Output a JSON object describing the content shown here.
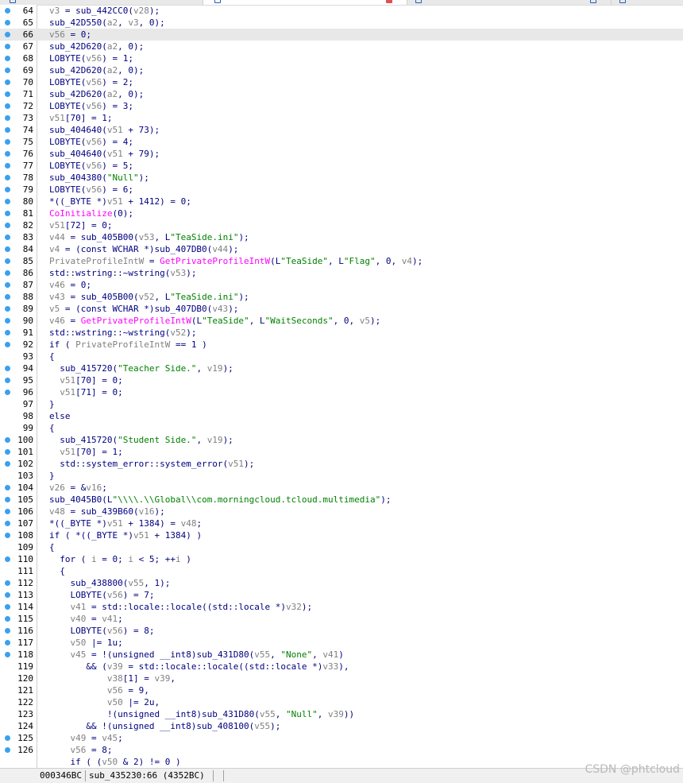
{
  "code_lines": [
    {
      "n": "64",
      "bp": true,
      "hl": false,
      "segs": [
        {
          "t": "v3",
          "c": "var"
        },
        {
          "t": " = sub_442CC0("
        },
        {
          "t": "v28",
          "c": "var"
        },
        {
          "t": ");"
        }
      ]
    },
    {
      "n": "65",
      "bp": true,
      "hl": false,
      "segs": [
        {
          "t": "sub_42D550("
        },
        {
          "t": "a2",
          "c": "var"
        },
        {
          "t": ", "
        },
        {
          "t": "v3",
          "c": "var"
        },
        {
          "t": ", 0);"
        }
      ]
    },
    {
      "n": "66",
      "bp": true,
      "hl": true,
      "segs": [
        {
          "t": "v56",
          "c": "var"
        },
        {
          "t": " = 0;"
        }
      ]
    },
    {
      "n": "67",
      "bp": true,
      "hl": false,
      "segs": [
        {
          "t": "sub_42D620("
        },
        {
          "t": "a2",
          "c": "var"
        },
        {
          "t": ", 0);"
        }
      ]
    },
    {
      "n": "68",
      "bp": true,
      "hl": false,
      "segs": [
        {
          "t": "LOBYTE("
        },
        {
          "t": "v56",
          "c": "var"
        },
        {
          "t": ") = 1;"
        }
      ]
    },
    {
      "n": "69",
      "bp": true,
      "hl": false,
      "segs": [
        {
          "t": "sub_42D620("
        },
        {
          "t": "a2",
          "c": "var"
        },
        {
          "t": ", 0);"
        }
      ]
    },
    {
      "n": "70",
      "bp": true,
      "hl": false,
      "segs": [
        {
          "t": "LOBYTE("
        },
        {
          "t": "v56",
          "c": "var"
        },
        {
          "t": ") = 2;"
        }
      ]
    },
    {
      "n": "71",
      "bp": true,
      "hl": false,
      "segs": [
        {
          "t": "sub_42D620("
        },
        {
          "t": "a2",
          "c": "var"
        },
        {
          "t": ", 0);"
        }
      ]
    },
    {
      "n": "72",
      "bp": true,
      "hl": false,
      "segs": [
        {
          "t": "LOBYTE("
        },
        {
          "t": "v56",
          "c": "var"
        },
        {
          "t": ") = 3;"
        }
      ]
    },
    {
      "n": "73",
      "bp": true,
      "hl": false,
      "segs": [
        {
          "t": "v51",
          "c": "var"
        },
        {
          "t": "[70] = 1;"
        }
      ]
    },
    {
      "n": "74",
      "bp": true,
      "hl": false,
      "segs": [
        {
          "t": "sub_404640("
        },
        {
          "t": "v51",
          "c": "var"
        },
        {
          "t": " + 73);"
        }
      ]
    },
    {
      "n": "75",
      "bp": true,
      "hl": false,
      "segs": [
        {
          "t": "LOBYTE("
        },
        {
          "t": "v56",
          "c": "var"
        },
        {
          "t": ") = 4;"
        }
      ]
    },
    {
      "n": "76",
      "bp": true,
      "hl": false,
      "segs": [
        {
          "t": "sub_404640("
        },
        {
          "t": "v51",
          "c": "var"
        },
        {
          "t": " + 79);"
        }
      ]
    },
    {
      "n": "77",
      "bp": true,
      "hl": false,
      "segs": [
        {
          "t": "LOBYTE("
        },
        {
          "t": "v56",
          "c": "var"
        },
        {
          "t": ") = 5;"
        }
      ]
    },
    {
      "n": "78",
      "bp": true,
      "hl": false,
      "segs": [
        {
          "t": "sub_404380("
        },
        {
          "t": "\"Null\"",
          "c": "str"
        },
        {
          "t": ");"
        }
      ]
    },
    {
      "n": "79",
      "bp": true,
      "hl": false,
      "segs": [
        {
          "t": "LOBYTE("
        },
        {
          "t": "v56",
          "c": "var"
        },
        {
          "t": ") = 6;"
        }
      ]
    },
    {
      "n": "80",
      "bp": true,
      "hl": false,
      "segs": [
        {
          "t": "*((_BYTE *)"
        },
        {
          "t": "v51",
          "c": "var"
        },
        {
          "t": " + 1412) = 0;"
        }
      ]
    },
    {
      "n": "81",
      "bp": true,
      "hl": false,
      "segs": [
        {
          "t": "CoInitialize",
          "c": "fn"
        },
        {
          "t": "(0);"
        }
      ]
    },
    {
      "n": "82",
      "bp": true,
      "hl": false,
      "segs": [
        {
          "t": "v51",
          "c": "var"
        },
        {
          "t": "[72] = 0;"
        }
      ]
    },
    {
      "n": "83",
      "bp": true,
      "hl": false,
      "segs": [
        {
          "t": "v44",
          "c": "var"
        },
        {
          "t": " = sub_405B00("
        },
        {
          "t": "v53",
          "c": "var"
        },
        {
          "t": ", L"
        },
        {
          "t": "\"TeaSide.ini\"",
          "c": "str"
        },
        {
          "t": ");"
        }
      ]
    },
    {
      "n": "84",
      "bp": true,
      "hl": false,
      "segs": [
        {
          "t": "v4",
          "c": "var"
        },
        {
          "t": " = (const WCHAR *)sub_407DB0("
        },
        {
          "t": "v44",
          "c": "var"
        },
        {
          "t": ");"
        }
      ]
    },
    {
      "n": "85",
      "bp": true,
      "hl": false,
      "segs": [
        {
          "t": "PrivateProfileIntW",
          "c": "var"
        },
        {
          "t": " = "
        },
        {
          "t": "GetPrivateProfileIntW",
          "c": "fn"
        },
        {
          "t": "(L"
        },
        {
          "t": "\"TeaSide\"",
          "c": "str"
        },
        {
          "t": ", L"
        },
        {
          "t": "\"Flag\"",
          "c": "str"
        },
        {
          "t": ", 0, "
        },
        {
          "t": "v4",
          "c": "var"
        },
        {
          "t": ");"
        }
      ]
    },
    {
      "n": "86",
      "bp": true,
      "hl": false,
      "segs": [
        {
          "t": "std::wstring::~wstring("
        },
        {
          "t": "v53",
          "c": "var"
        },
        {
          "t": ");"
        }
      ]
    },
    {
      "n": "87",
      "bp": true,
      "hl": false,
      "segs": [
        {
          "t": "v46",
          "c": "var"
        },
        {
          "t": " = 0;"
        }
      ]
    },
    {
      "n": "88",
      "bp": true,
      "hl": false,
      "segs": [
        {
          "t": "v43",
          "c": "var"
        },
        {
          "t": " = sub_405B00("
        },
        {
          "t": "v52",
          "c": "var"
        },
        {
          "t": ", L"
        },
        {
          "t": "\"TeaSide.ini\"",
          "c": "str"
        },
        {
          "t": ");"
        }
      ]
    },
    {
      "n": "89",
      "bp": true,
      "hl": false,
      "segs": [
        {
          "t": "v5",
          "c": "var"
        },
        {
          "t": " = (const WCHAR *)sub_407DB0("
        },
        {
          "t": "v43",
          "c": "var"
        },
        {
          "t": ");"
        }
      ]
    },
    {
      "n": "90",
      "bp": true,
      "hl": false,
      "segs": [
        {
          "t": "v46",
          "c": "var"
        },
        {
          "t": " = "
        },
        {
          "t": "GetPrivateProfileIntW",
          "c": "fn"
        },
        {
          "t": "(L"
        },
        {
          "t": "\"TeaSide\"",
          "c": "str"
        },
        {
          "t": ", L"
        },
        {
          "t": "\"WaitSeconds\"",
          "c": "str"
        },
        {
          "t": ", 0, "
        },
        {
          "t": "v5",
          "c": "var"
        },
        {
          "t": ");"
        }
      ]
    },
    {
      "n": "91",
      "bp": true,
      "hl": false,
      "segs": [
        {
          "t": "std::wstring::~wstring("
        },
        {
          "t": "v52",
          "c": "var"
        },
        {
          "t": ");"
        }
      ]
    },
    {
      "n": "92",
      "bp": true,
      "hl": false,
      "segs": [
        {
          "t": "if ( "
        },
        {
          "t": "PrivateProfileIntW",
          "c": "var"
        },
        {
          "t": " == 1 )"
        }
      ]
    },
    {
      "n": "93",
      "bp": false,
      "hl": false,
      "segs": [
        {
          "t": "{"
        }
      ]
    },
    {
      "n": "94",
      "bp": true,
      "hl": false,
      "segs": [
        {
          "t": "  sub_415720("
        },
        {
          "t": "\"Teacher Side.\"",
          "c": "str"
        },
        {
          "t": ", "
        },
        {
          "t": "v19",
          "c": "var"
        },
        {
          "t": ");"
        }
      ]
    },
    {
      "n": "95",
      "bp": true,
      "hl": false,
      "segs": [
        {
          "t": "  "
        },
        {
          "t": "v51",
          "c": "var"
        },
        {
          "t": "[70] = 0;"
        }
      ]
    },
    {
      "n": "96",
      "bp": true,
      "hl": false,
      "segs": [
        {
          "t": "  "
        },
        {
          "t": "v51",
          "c": "var"
        },
        {
          "t": "[71] = 0;"
        }
      ]
    },
    {
      "n": "97",
      "bp": false,
      "hl": false,
      "segs": [
        {
          "t": "}"
        }
      ]
    },
    {
      "n": "98",
      "bp": false,
      "hl": false,
      "segs": [
        {
          "t": "else"
        }
      ]
    },
    {
      "n": "99",
      "bp": false,
      "hl": false,
      "segs": [
        {
          "t": "{"
        }
      ]
    },
    {
      "n": "100",
      "bp": true,
      "hl": false,
      "segs": [
        {
          "t": "  sub_415720("
        },
        {
          "t": "\"Student Side.\"",
          "c": "str"
        },
        {
          "t": ", "
        },
        {
          "t": "v19",
          "c": "var"
        },
        {
          "t": ");"
        }
      ]
    },
    {
      "n": "101",
      "bp": true,
      "hl": false,
      "segs": [
        {
          "t": "  "
        },
        {
          "t": "v51",
          "c": "var"
        },
        {
          "t": "[70] = 1;"
        }
      ]
    },
    {
      "n": "102",
      "bp": true,
      "hl": false,
      "segs": [
        {
          "t": "  std::system_error::system_error("
        },
        {
          "t": "v51",
          "c": "var"
        },
        {
          "t": ");"
        }
      ]
    },
    {
      "n": "103",
      "bp": false,
      "hl": false,
      "segs": [
        {
          "t": "}"
        }
      ]
    },
    {
      "n": "104",
      "bp": true,
      "hl": false,
      "segs": [
        {
          "t": "v26",
          "c": "var"
        },
        {
          "t": " = &"
        },
        {
          "t": "v16",
          "c": "var"
        },
        {
          "t": ";"
        }
      ]
    },
    {
      "n": "105",
      "bp": true,
      "hl": false,
      "segs": [
        {
          "t": "sub_4045B0(L"
        },
        {
          "t": "\"\\\\\\\\.\\\\Global\\\\com.morningcloud.tcloud.multimedia\"",
          "c": "str"
        },
        {
          "t": ");"
        }
      ]
    },
    {
      "n": "106",
      "bp": true,
      "hl": false,
      "segs": [
        {
          "t": "v48",
          "c": "var"
        },
        {
          "t": " = sub_439B60("
        },
        {
          "t": "v16",
          "c": "var"
        },
        {
          "t": ");"
        }
      ]
    },
    {
      "n": "107",
      "bp": true,
      "hl": false,
      "segs": [
        {
          "t": "*((_BYTE *)"
        },
        {
          "t": "v51",
          "c": "var"
        },
        {
          "t": " + 1384) = "
        },
        {
          "t": "v48",
          "c": "var"
        },
        {
          "t": ";"
        }
      ]
    },
    {
      "n": "108",
      "bp": true,
      "hl": false,
      "segs": [
        {
          "t": "if ( *((_BYTE *)"
        },
        {
          "t": "v51",
          "c": "var"
        },
        {
          "t": " + 1384) )"
        }
      ]
    },
    {
      "n": "109",
      "bp": false,
      "hl": false,
      "segs": [
        {
          "t": "{"
        }
      ]
    },
    {
      "n": "110",
      "bp": true,
      "hl": false,
      "segs": [
        {
          "t": "  for ( "
        },
        {
          "t": "i",
          "c": "var"
        },
        {
          "t": " = 0; "
        },
        {
          "t": "i",
          "c": "var"
        },
        {
          "t": " < 5; ++"
        },
        {
          "t": "i",
          "c": "var"
        },
        {
          "t": " )"
        }
      ]
    },
    {
      "n": "111",
      "bp": false,
      "hl": false,
      "segs": [
        {
          "t": "  {"
        }
      ]
    },
    {
      "n": "112",
      "bp": true,
      "hl": false,
      "segs": [
        {
          "t": "    sub_438800("
        },
        {
          "t": "v55",
          "c": "var"
        },
        {
          "t": ", 1);"
        }
      ]
    },
    {
      "n": "113",
      "bp": true,
      "hl": false,
      "segs": [
        {
          "t": "    LOBYTE("
        },
        {
          "t": "v56",
          "c": "var"
        },
        {
          "t": ") = 7;"
        }
      ]
    },
    {
      "n": "114",
      "bp": true,
      "hl": false,
      "segs": [
        {
          "t": "    "
        },
        {
          "t": "v41",
          "c": "var"
        },
        {
          "t": " = std::locale::locale((std::locale *)"
        },
        {
          "t": "v32",
          "c": "var"
        },
        {
          "t": ");"
        }
      ]
    },
    {
      "n": "115",
      "bp": true,
      "hl": false,
      "segs": [
        {
          "t": "    "
        },
        {
          "t": "v40",
          "c": "var"
        },
        {
          "t": " = "
        },
        {
          "t": "v41",
          "c": "var"
        },
        {
          "t": ";"
        }
      ]
    },
    {
      "n": "116",
      "bp": true,
      "hl": false,
      "segs": [
        {
          "t": "    LOBYTE("
        },
        {
          "t": "v56",
          "c": "var"
        },
        {
          "t": ") = 8;"
        }
      ]
    },
    {
      "n": "117",
      "bp": true,
      "hl": false,
      "segs": [
        {
          "t": "    "
        },
        {
          "t": "v50",
          "c": "var"
        },
        {
          "t": " |= 1u;"
        }
      ]
    },
    {
      "n": "118",
      "bp": true,
      "hl": false,
      "segs": [
        {
          "t": "    "
        },
        {
          "t": "v45",
          "c": "var"
        },
        {
          "t": " = !(unsigned __int8)sub_431D80("
        },
        {
          "t": "v55",
          "c": "var"
        },
        {
          "t": ", "
        },
        {
          "t": "\"None\"",
          "c": "str"
        },
        {
          "t": ", "
        },
        {
          "t": "v41",
          "c": "var"
        },
        {
          "t": ")"
        }
      ]
    },
    {
      "n": "119",
      "bp": false,
      "hl": false,
      "segs": [
        {
          "t": "       && ("
        },
        {
          "t": "v39",
          "c": "var"
        },
        {
          "t": " = std::locale::locale((std::locale *)"
        },
        {
          "t": "v33",
          "c": "var"
        },
        {
          "t": "),"
        }
      ]
    },
    {
      "n": "120",
      "bp": false,
      "hl": false,
      "segs": [
        {
          "t": "           "
        },
        {
          "t": "v38",
          "c": "var"
        },
        {
          "t": "[1] = "
        },
        {
          "t": "v39",
          "c": "var"
        },
        {
          "t": ","
        }
      ]
    },
    {
      "n": "121",
      "bp": false,
      "hl": false,
      "segs": [
        {
          "t": "           "
        },
        {
          "t": "v56",
          "c": "var"
        },
        {
          "t": " = 9,"
        }
      ]
    },
    {
      "n": "122",
      "bp": false,
      "hl": false,
      "segs": [
        {
          "t": "           "
        },
        {
          "t": "v50",
          "c": "var"
        },
        {
          "t": " |= 2u,"
        }
      ]
    },
    {
      "n": "123",
      "bp": false,
      "hl": false,
      "segs": [
        {
          "t": "           !(unsigned __int8)sub_431D80("
        },
        {
          "t": "v55",
          "c": "var"
        },
        {
          "t": ", "
        },
        {
          "t": "\"Null\"",
          "c": "str"
        },
        {
          "t": ", "
        },
        {
          "t": "v39",
          "c": "var"
        },
        {
          "t": "))"
        }
      ]
    },
    {
      "n": "124",
      "bp": false,
      "hl": false,
      "segs": [
        {
          "t": "       && !(unsigned __int8)sub_408100("
        },
        {
          "t": "v55",
          "c": "var"
        },
        {
          "t": ");"
        }
      ]
    },
    {
      "n": "125",
      "bp": true,
      "hl": false,
      "segs": [
        {
          "t": "    "
        },
        {
          "t": "v49",
          "c": "var"
        },
        {
          "t": " = "
        },
        {
          "t": "v45",
          "c": "var"
        },
        {
          "t": ";"
        }
      ]
    },
    {
      "n": "126",
      "bp": true,
      "hl": false,
      "segs": [
        {
          "t": "    "
        },
        {
          "t": "v56",
          "c": "var"
        },
        {
          "t": " = 8;"
        }
      ]
    },
    {
      "n": "",
      "bp": false,
      "hl": false,
      "segs": [
        {
          "t": "    if ( ("
        },
        {
          "t": "v50",
          "c": "var"
        },
        {
          "t": " & 2) != 0 )"
        }
      ]
    }
  ],
  "status": {
    "address": "000346BC",
    "location": "sub_435230:66 (4352BC)"
  },
  "watermark": "CSDN @phtcloud",
  "colors": {
    "keyword": "#000080",
    "variable": "#808080",
    "function": "#ff00ff",
    "string": "#008000",
    "breakpoint_dot": "#3aa0f0",
    "highlight_row": "#e8e8e8"
  }
}
